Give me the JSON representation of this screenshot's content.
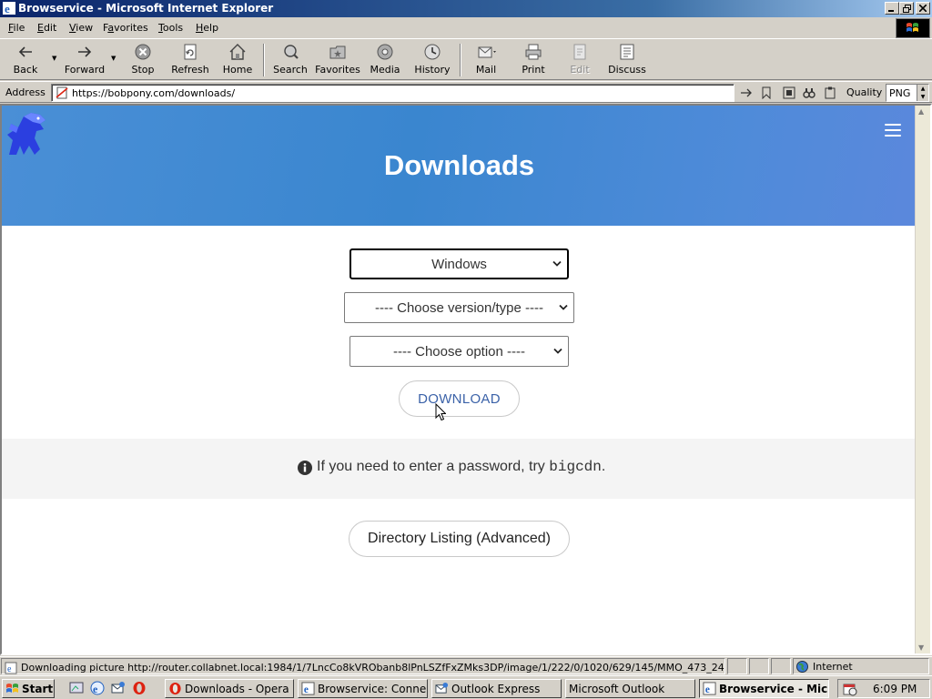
{
  "window": {
    "title": "Browservice - Microsoft Internet Explorer",
    "controls": [
      "minimize",
      "maximize",
      "close"
    ]
  },
  "menu": {
    "items": [
      {
        "label": "File",
        "accel": "F"
      },
      {
        "label": "Edit",
        "accel": "E"
      },
      {
        "label": "View",
        "accel": "V"
      },
      {
        "label": "Favorites",
        "accel": "a"
      },
      {
        "label": "Tools",
        "accel": "T"
      },
      {
        "label": "Help",
        "accel": "H"
      }
    ]
  },
  "toolbar": {
    "back": "Back",
    "forward": "Forward",
    "stop": "Stop",
    "refresh": "Refresh",
    "home": "Home",
    "search": "Search",
    "favorites": "Favorites",
    "media": "Media",
    "history": "History",
    "mail": "Mail",
    "print": "Print",
    "edit": "Edit",
    "discuss": "Discuss"
  },
  "address": {
    "label": "Address",
    "url": "https://bobpony.com/downloads/",
    "quality_label": "Quality",
    "quality_value": "PNG"
  },
  "page": {
    "heading": "Downloads",
    "os_select": "Windows",
    "version_select": "---- Choose version/type ----",
    "option_select": "---- Choose option ----",
    "download_button": "DOWNLOAD",
    "notice_prefix": "If you need to enter a password, try",
    "notice_password": "bigcdn",
    "notice_suffix": ".",
    "directory_button": "Directory Listing (Advanced)",
    "accent_color": "#3b62a8"
  },
  "status": {
    "text": "Downloading picture http://router.collabnet.local:1984/1/7LncCo8kVRObanb8lPnLSZfFxZMks3DP/image/1/222/0/1020/629/145/MMO_473_24",
    "zone": "Internet"
  },
  "taskbar": {
    "start": "Start",
    "tasks": [
      {
        "label": "Downloads - Opera",
        "icon": "opera-icon"
      },
      {
        "label": "Browservice: Conne...",
        "icon": "ie-icon"
      },
      {
        "label": "Outlook Express",
        "icon": "outlook-express-icon"
      },
      {
        "label": "Microsoft Outlook",
        "icon": "outlook-icon"
      },
      {
        "label": "Browservice - Mic...",
        "icon": "ie-icon",
        "active": true
      }
    ],
    "clock": "6:09 PM"
  }
}
